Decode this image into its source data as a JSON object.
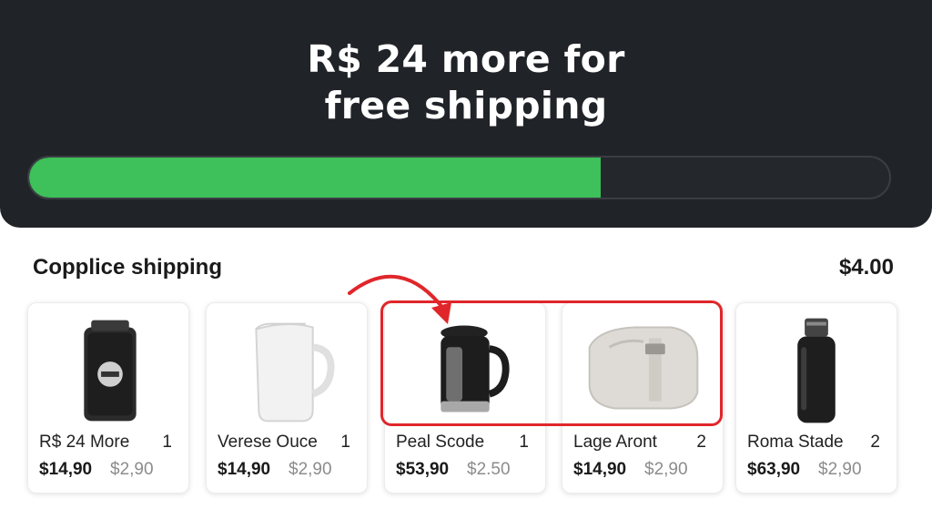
{
  "banner": {
    "title_line1": "R$ 24 more for",
    "title_line2": "free shipping",
    "progress": 0.665,
    "colors": {
      "background": "#202328",
      "fill": "#3ec05a"
    }
  },
  "shipping": {
    "label": "Copplice shipping",
    "price": "$4.00"
  },
  "products": [
    {
      "name": "R$ 24 More",
      "qty": "1",
      "price": "$14,90",
      "old_price": "$2,90",
      "icon": "black-case-icon"
    },
    {
      "name": "Verese Ouce",
      "qty": "1",
      "price": "$14,90",
      "old_price": "$2,90",
      "icon": "white-pitcher-icon"
    },
    {
      "name": "Peal Scode",
      "qty": "1",
      "price": "$53,90",
      "old_price": "$2.50",
      "icon": "black-kettle-icon"
    },
    {
      "name": "Lage Aront",
      "qty": "2",
      "price": "$14,90",
      "old_price": "$2,90",
      "icon": "gray-bag-icon"
    },
    {
      "name": "Roma Stade",
      "qty": "2",
      "price": "$63,90",
      "old_price": "$2,90",
      "icon": "black-bottle-icon"
    }
  ],
  "annotation": {
    "color": "#e0262b"
  }
}
